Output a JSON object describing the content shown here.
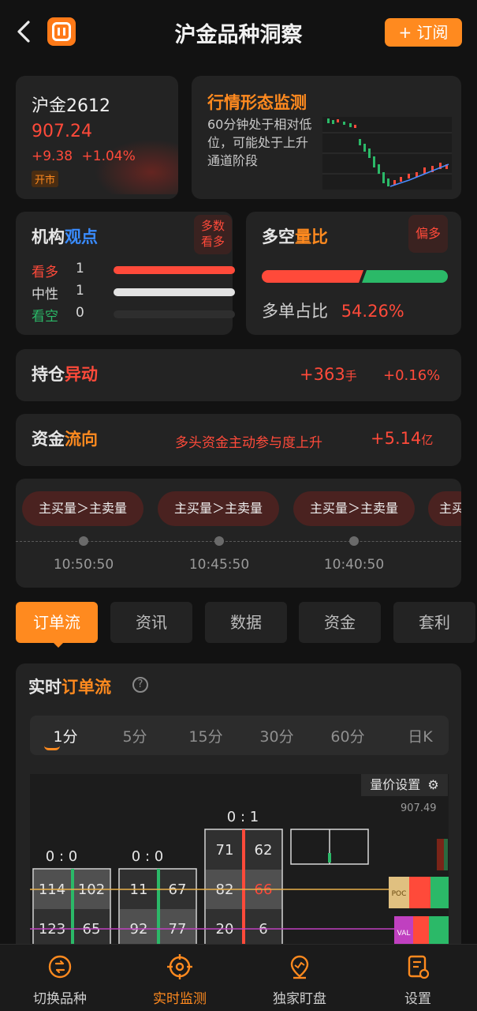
{
  "header": {
    "title": "沪金品种洞察",
    "subscribe_label": "+ 订阅"
  },
  "quote": {
    "symbol": "沪金2612",
    "price": "907.24",
    "change": "+9.38",
    "change_pct": "+1.04%",
    "status": "开市"
  },
  "pattern": {
    "title": "行情形态监测",
    "description": "60分钟处于相对低位，可能处于上升通道阶段"
  },
  "views": {
    "title_a": "机构",
    "title_b": "观点",
    "tag_line1": "多数",
    "tag_line2": "看多",
    "rows": [
      {
        "label": "看多",
        "count": "1",
        "fraction": 1.0
      },
      {
        "label": "中性",
        "count": "1",
        "fraction": 1.0
      },
      {
        "label": "看空",
        "count": "0",
        "fraction": 0.0
      }
    ]
  },
  "ratio": {
    "title_a": "多空",
    "title_b": "量比",
    "tag": "偏多",
    "label": "多单占比",
    "value": "54.26%",
    "long_fraction": 0.5426
  },
  "position": {
    "title_a": "持仓",
    "title_b": "异动",
    "change": "+363",
    "unit": "手",
    "pct": "+0.16%"
  },
  "flow": {
    "title_a": "资金",
    "title_b": "流向",
    "desc": "多头资金主动参与度上升",
    "value": "+5.14",
    "unit": "亿"
  },
  "timeline": {
    "items": [
      {
        "label": "主买量＞主卖量",
        "time": "10:50:50"
      },
      {
        "label": "主买量＞主卖量",
        "time": "10:45:50"
      },
      {
        "label": "主买量＞主卖量",
        "time": "10:40:50"
      },
      {
        "label": "主买",
        "time": ""
      }
    ]
  },
  "tabs": [
    "订单流",
    "资讯",
    "数据",
    "资金",
    "套利"
  ],
  "orderflow": {
    "title_a": "实时",
    "title_b": "订单流",
    "periods": [
      "1分",
      "5分",
      "15分",
      "30分",
      "60分",
      "日K"
    ],
    "settings_label": "量价设置",
    "top_price": "907.49",
    "poc_label": "POC",
    "val_label": "VAL",
    "columns": [
      {
        "header": "0 : 0",
        "rows": [
          [
            "114",
            "102"
          ],
          [
            "123",
            "65"
          ]
        ]
      },
      {
        "header": "0 : 0",
        "rows": [
          [
            "11",
            "67"
          ],
          [
            "92",
            "77"
          ]
        ]
      },
      {
        "header": "0 : 1",
        "rows": [
          [
            "71",
            "62"
          ],
          [
            "82",
            "66"
          ],
          [
            "20",
            "6"
          ]
        ]
      }
    ]
  },
  "nav": [
    "切换品种",
    "实时监测",
    "独家盯盘",
    "设置"
  ],
  "colors": {
    "accent": "#ff8a1f",
    "up": "#ff4a3a",
    "down": "#2bb968",
    "background": "#121212",
    "card": "#232323"
  }
}
